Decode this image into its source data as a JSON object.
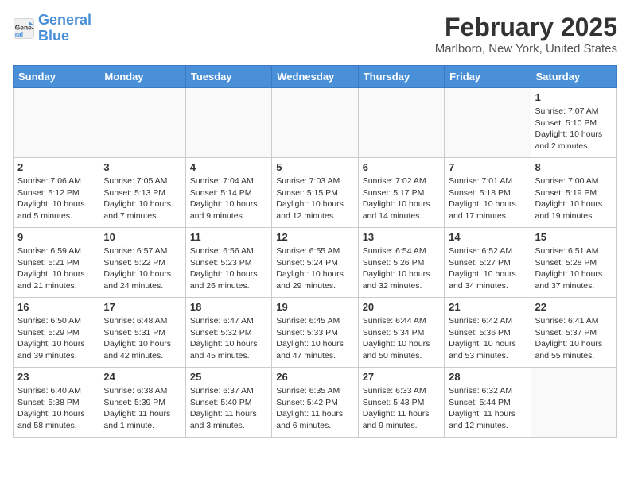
{
  "header": {
    "logo_line1": "General",
    "logo_line2": "Blue",
    "month_year": "February 2025",
    "location": "Marlboro, New York, United States"
  },
  "days_of_week": [
    "Sunday",
    "Monday",
    "Tuesday",
    "Wednesday",
    "Thursday",
    "Friday",
    "Saturday"
  ],
  "weeks": [
    [
      {
        "day": "",
        "info": ""
      },
      {
        "day": "",
        "info": ""
      },
      {
        "day": "",
        "info": ""
      },
      {
        "day": "",
        "info": ""
      },
      {
        "day": "",
        "info": ""
      },
      {
        "day": "",
        "info": ""
      },
      {
        "day": "1",
        "info": "Sunrise: 7:07 AM\nSunset: 5:10 PM\nDaylight: 10 hours and 2 minutes."
      }
    ],
    [
      {
        "day": "2",
        "info": "Sunrise: 7:06 AM\nSunset: 5:12 PM\nDaylight: 10 hours and 5 minutes."
      },
      {
        "day": "3",
        "info": "Sunrise: 7:05 AM\nSunset: 5:13 PM\nDaylight: 10 hours and 7 minutes."
      },
      {
        "day": "4",
        "info": "Sunrise: 7:04 AM\nSunset: 5:14 PM\nDaylight: 10 hours and 9 minutes."
      },
      {
        "day": "5",
        "info": "Sunrise: 7:03 AM\nSunset: 5:15 PM\nDaylight: 10 hours and 12 minutes."
      },
      {
        "day": "6",
        "info": "Sunrise: 7:02 AM\nSunset: 5:17 PM\nDaylight: 10 hours and 14 minutes."
      },
      {
        "day": "7",
        "info": "Sunrise: 7:01 AM\nSunset: 5:18 PM\nDaylight: 10 hours and 17 minutes."
      },
      {
        "day": "8",
        "info": "Sunrise: 7:00 AM\nSunset: 5:19 PM\nDaylight: 10 hours and 19 minutes."
      }
    ],
    [
      {
        "day": "9",
        "info": "Sunrise: 6:59 AM\nSunset: 5:21 PM\nDaylight: 10 hours and 21 minutes."
      },
      {
        "day": "10",
        "info": "Sunrise: 6:57 AM\nSunset: 5:22 PM\nDaylight: 10 hours and 24 minutes."
      },
      {
        "day": "11",
        "info": "Sunrise: 6:56 AM\nSunset: 5:23 PM\nDaylight: 10 hours and 26 minutes."
      },
      {
        "day": "12",
        "info": "Sunrise: 6:55 AM\nSunset: 5:24 PM\nDaylight: 10 hours and 29 minutes."
      },
      {
        "day": "13",
        "info": "Sunrise: 6:54 AM\nSunset: 5:26 PM\nDaylight: 10 hours and 32 minutes."
      },
      {
        "day": "14",
        "info": "Sunrise: 6:52 AM\nSunset: 5:27 PM\nDaylight: 10 hours and 34 minutes."
      },
      {
        "day": "15",
        "info": "Sunrise: 6:51 AM\nSunset: 5:28 PM\nDaylight: 10 hours and 37 minutes."
      }
    ],
    [
      {
        "day": "16",
        "info": "Sunrise: 6:50 AM\nSunset: 5:29 PM\nDaylight: 10 hours and 39 minutes."
      },
      {
        "day": "17",
        "info": "Sunrise: 6:48 AM\nSunset: 5:31 PM\nDaylight: 10 hours and 42 minutes."
      },
      {
        "day": "18",
        "info": "Sunrise: 6:47 AM\nSunset: 5:32 PM\nDaylight: 10 hours and 45 minutes."
      },
      {
        "day": "19",
        "info": "Sunrise: 6:45 AM\nSunset: 5:33 PM\nDaylight: 10 hours and 47 minutes."
      },
      {
        "day": "20",
        "info": "Sunrise: 6:44 AM\nSunset: 5:34 PM\nDaylight: 10 hours and 50 minutes."
      },
      {
        "day": "21",
        "info": "Sunrise: 6:42 AM\nSunset: 5:36 PM\nDaylight: 10 hours and 53 minutes."
      },
      {
        "day": "22",
        "info": "Sunrise: 6:41 AM\nSunset: 5:37 PM\nDaylight: 10 hours and 55 minutes."
      }
    ],
    [
      {
        "day": "23",
        "info": "Sunrise: 6:40 AM\nSunset: 5:38 PM\nDaylight: 10 hours and 58 minutes."
      },
      {
        "day": "24",
        "info": "Sunrise: 6:38 AM\nSunset: 5:39 PM\nDaylight: 11 hours and 1 minute."
      },
      {
        "day": "25",
        "info": "Sunrise: 6:37 AM\nSunset: 5:40 PM\nDaylight: 11 hours and 3 minutes."
      },
      {
        "day": "26",
        "info": "Sunrise: 6:35 AM\nSunset: 5:42 PM\nDaylight: 11 hours and 6 minutes."
      },
      {
        "day": "27",
        "info": "Sunrise: 6:33 AM\nSunset: 5:43 PM\nDaylight: 11 hours and 9 minutes."
      },
      {
        "day": "28",
        "info": "Sunrise: 6:32 AM\nSunset: 5:44 PM\nDaylight: 11 hours and 12 minutes."
      },
      {
        "day": "",
        "info": ""
      }
    ]
  ]
}
